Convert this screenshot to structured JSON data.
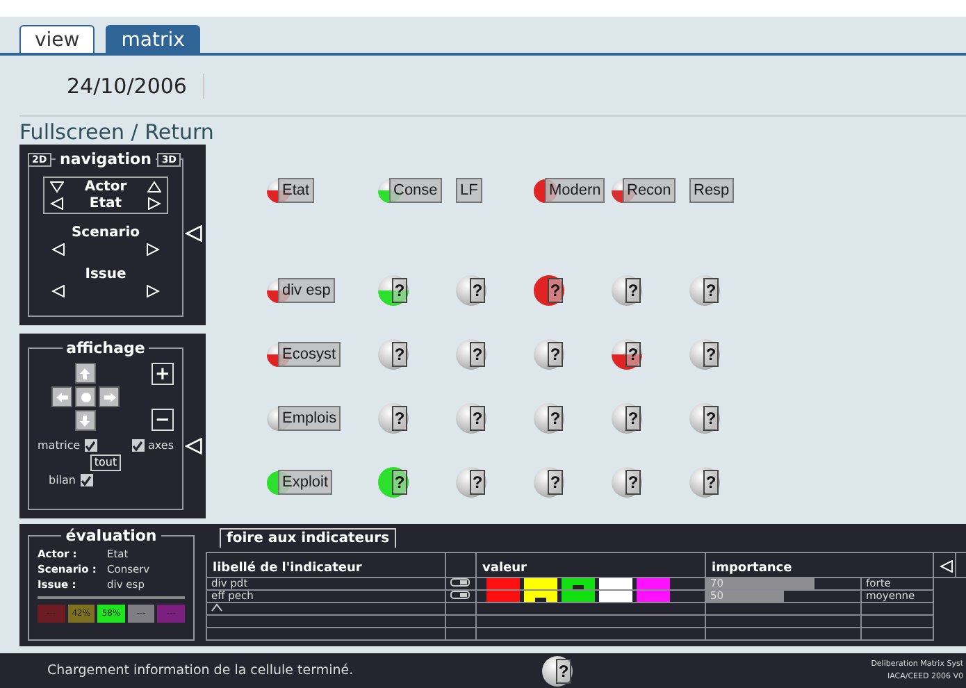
{
  "tabs": [
    {
      "label": "view",
      "selected": false
    },
    {
      "label": "matrix",
      "selected": true
    }
  ],
  "date": "24/10/2006",
  "fullscreen_link": "Fullscreen / Return",
  "navigation": {
    "title": "navigation",
    "badge_left": "2D",
    "badge_right": "3D",
    "actor_label": "Actor",
    "actor_value": "Etat",
    "scenario_label": "Scenario",
    "issue_label": "Issue"
  },
  "affichage": {
    "title": "affichage",
    "zoom_in": "+",
    "zoom_out": "−",
    "all_button": "tout",
    "checkboxes": [
      {
        "label": "matrice",
        "checked": true
      },
      {
        "label": "axes",
        "checked": true
      },
      {
        "label": "bilan",
        "checked": true
      }
    ]
  },
  "matrix": {
    "corner": {
      "label": "Etat",
      "color": "#e02424",
      "kind": "half"
    },
    "columns": [
      {
        "label": "Conse",
        "color": "#2ee02e",
        "kind": "half"
      },
      {
        "label": "LF"
      },
      {
        "label": "Modern",
        "color": "#e02424",
        "kind": "full"
      },
      {
        "label": "Recon",
        "color": "#d83030",
        "kind": "half"
      },
      {
        "label": "Resp"
      }
    ],
    "rows": [
      {
        "label": "div esp",
        "color": "#e02424",
        "kind": "half",
        "cells": [
          {
            "text": "?",
            "color": "#2ee02e",
            "kind": "half"
          },
          {
            "text": "?"
          },
          {
            "text": "?",
            "color": "#e02424",
            "kind": "full"
          },
          {
            "text": "?"
          },
          {
            "text": "?"
          }
        ]
      },
      {
        "label": "Ecosyst",
        "color": "#e02424",
        "kind": "half",
        "cells": [
          {
            "text": "?"
          },
          {
            "text": "?"
          },
          {
            "text": "?"
          },
          {
            "text": "?",
            "color": "#e02424",
            "kind": "half"
          },
          {
            "text": "?"
          }
        ]
      },
      {
        "label": "Emplois",
        "cells": [
          {
            "text": "?"
          },
          {
            "text": "?"
          },
          {
            "text": "?"
          },
          {
            "text": "?"
          },
          {
            "text": "?"
          }
        ]
      },
      {
        "label": "Exploit",
        "color": "#2ee02e",
        "kind": "full",
        "cells": [
          {
            "text": "?",
            "color": "#2ee02e",
            "kind": "full"
          },
          {
            "text": "?"
          },
          {
            "text": "?"
          },
          {
            "text": "?"
          },
          {
            "text": "?"
          }
        ]
      }
    ]
  },
  "evaluation": {
    "title": "évaluation",
    "rows": [
      {
        "label": "Actor :",
        "value": "Etat"
      },
      {
        "label": "Scenario :",
        "value": "Conserv"
      },
      {
        "label": "Issue :",
        "value": "div esp"
      }
    ],
    "chips": [
      {
        "text": "---",
        "color": "#6e1c24"
      },
      {
        "text": "42%",
        "color": "#7d7020"
      },
      {
        "text": "58%",
        "color": "#1ee61e"
      },
      {
        "text": "---",
        "color": "#7e7e84"
      },
      {
        "text": "---",
        "color": "#7c2080"
      }
    ]
  },
  "indicators": {
    "title": "foire aux indicateurs",
    "columns": [
      "libellé de l'indicateur",
      "valeur",
      "importance"
    ],
    "rows": [
      {
        "label": "div pdt",
        "segments": [
          {
            "color": "#ff1010",
            "selected": false
          },
          {
            "color": "#ffff00",
            "selected": false
          },
          {
            "color": "#10e010",
            "selected": true
          },
          {
            "color": "#ffffff",
            "selected": false
          },
          {
            "color": "#ff10ff",
            "selected": false
          }
        ],
        "importance": {
          "value": "70",
          "level": 0.7
        },
        "importance_label": "forte"
      },
      {
        "label": "eff pech",
        "segments": [
          {
            "color": "#ff1010",
            "selected": false
          },
          {
            "color": "#ffff00",
            "selected": true
          },
          {
            "color": "#10e010",
            "selected": false
          },
          {
            "color": "#ffffff",
            "selected": false
          },
          {
            "color": "#ff10ff",
            "selected": false
          }
        ],
        "importance": {
          "value": "50",
          "level": 0.5
        },
        "importance_label": "moyenne"
      }
    ]
  },
  "status": {
    "message": "Chargement information de la cellule terminé.",
    "help": "?",
    "credit_lines": [
      "Deliberation Matrix Syst",
      "IACA/CEED 2006 V0"
    ]
  }
}
